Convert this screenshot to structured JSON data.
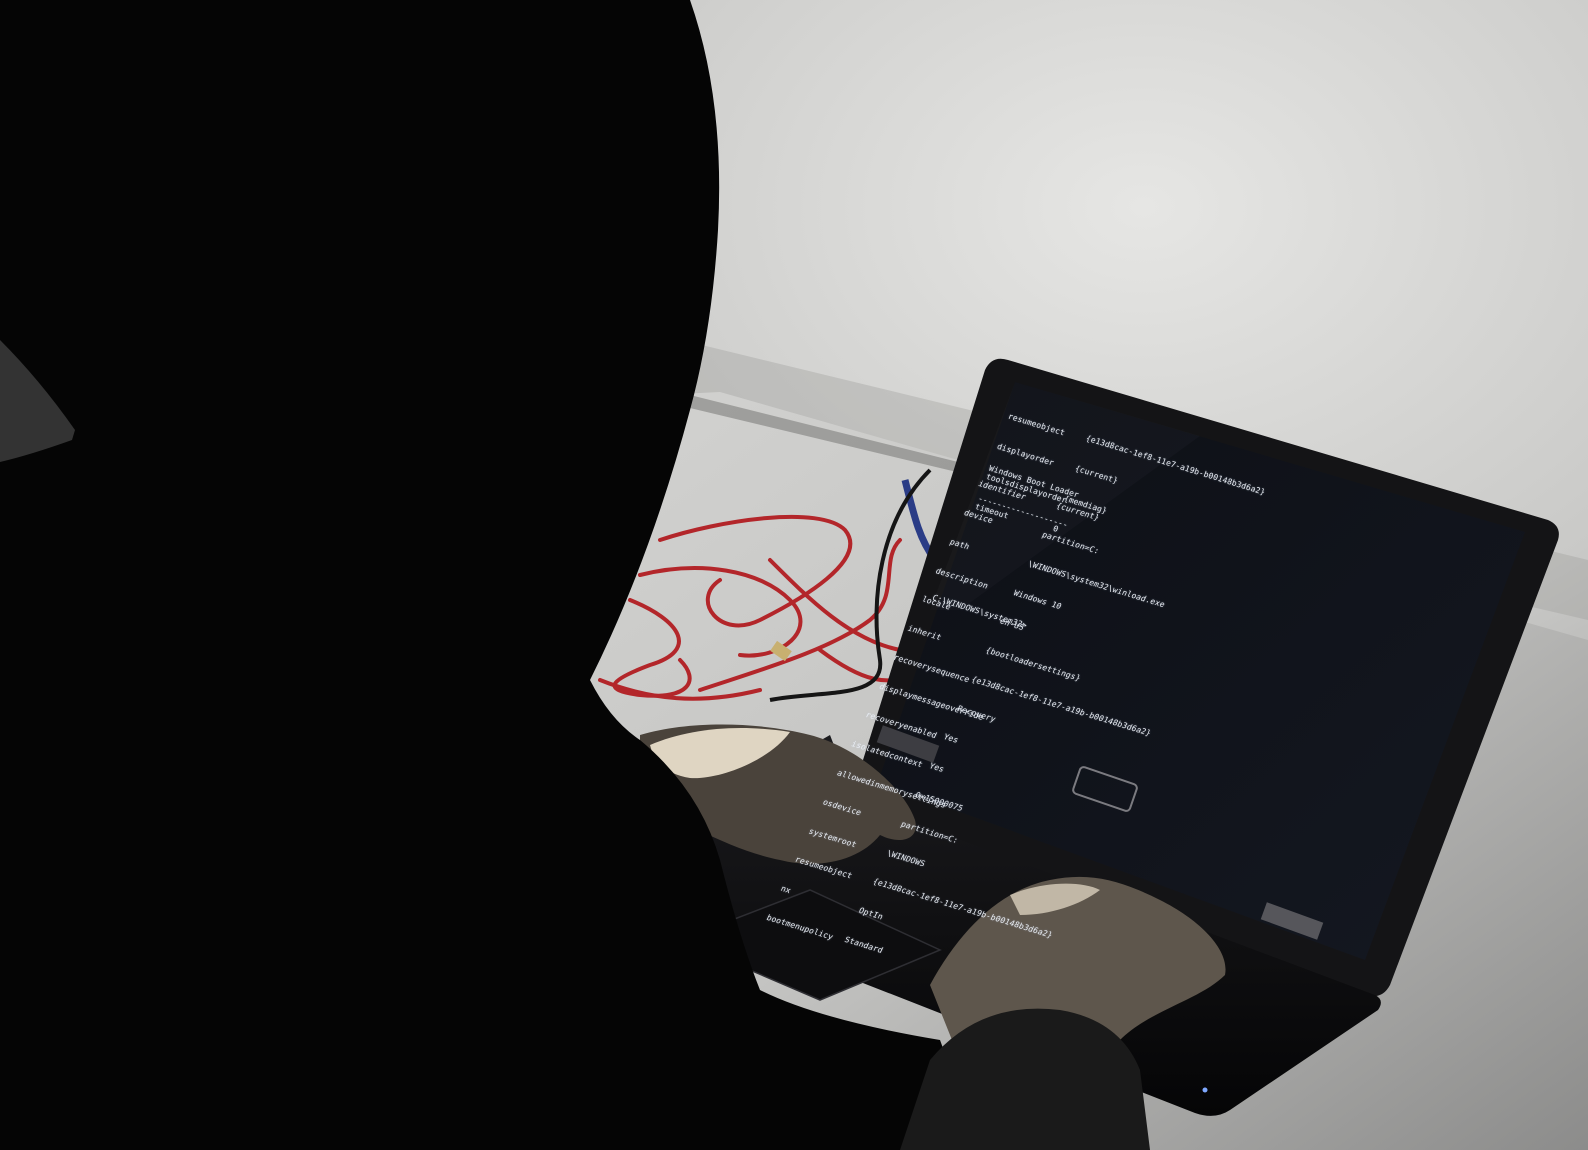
{
  "terminal": {
    "header_keys": [
      "resumeobject",
      "displayorder",
      "toolsdisplayorder",
      "timeout"
    ],
    "header_values": [
      "{e13d8cac-1ef8-11e7-a19b-b00148b3d6a2}",
      "{current}",
      "{memdiag}",
      "0"
    ],
    "section_title": "Windows Boot Loader",
    "section_rule": "-------------------",
    "entry_keys": [
      "identifier",
      "device",
      "path",
      "description",
      "locale",
      "inherit",
      "recoverysequence",
      "displaymessageoverride",
      "recoveryenabled",
      "isolatedcontext",
      "allowedinmemorysettings",
      "osdevice",
      "systemroot",
      "resumeobject",
      "nx",
      "bootmenupolicy"
    ],
    "entry_values": [
      "{current}",
      "partition=C:",
      "\\WINDOWS\\system32\\winload.exe",
      "Windows 10",
      "en-US",
      "{bootloadersettings}",
      "{e13d8cac-1ef8-11e7-a19b-b00148b3d6a2}",
      "Recovery",
      "Yes",
      "Yes",
      "0x15000075",
      "partition=C:",
      "\\WINDOWS",
      "{e13d8cac-1ef8-11e7-a19b-b00148b3d6a2}",
      "OptIn",
      "Standard"
    ],
    "prompt": "C:\\WINDOWS\\system32>"
  },
  "colors": {
    "wall": "#cfcfcd",
    "desk": "#d8d8d6",
    "silhouette": "#050505",
    "laptop_body": "#121214",
    "screen": "#0b0d12",
    "terminal_text": "#e8ecf2",
    "cable": "#b3262a"
  }
}
